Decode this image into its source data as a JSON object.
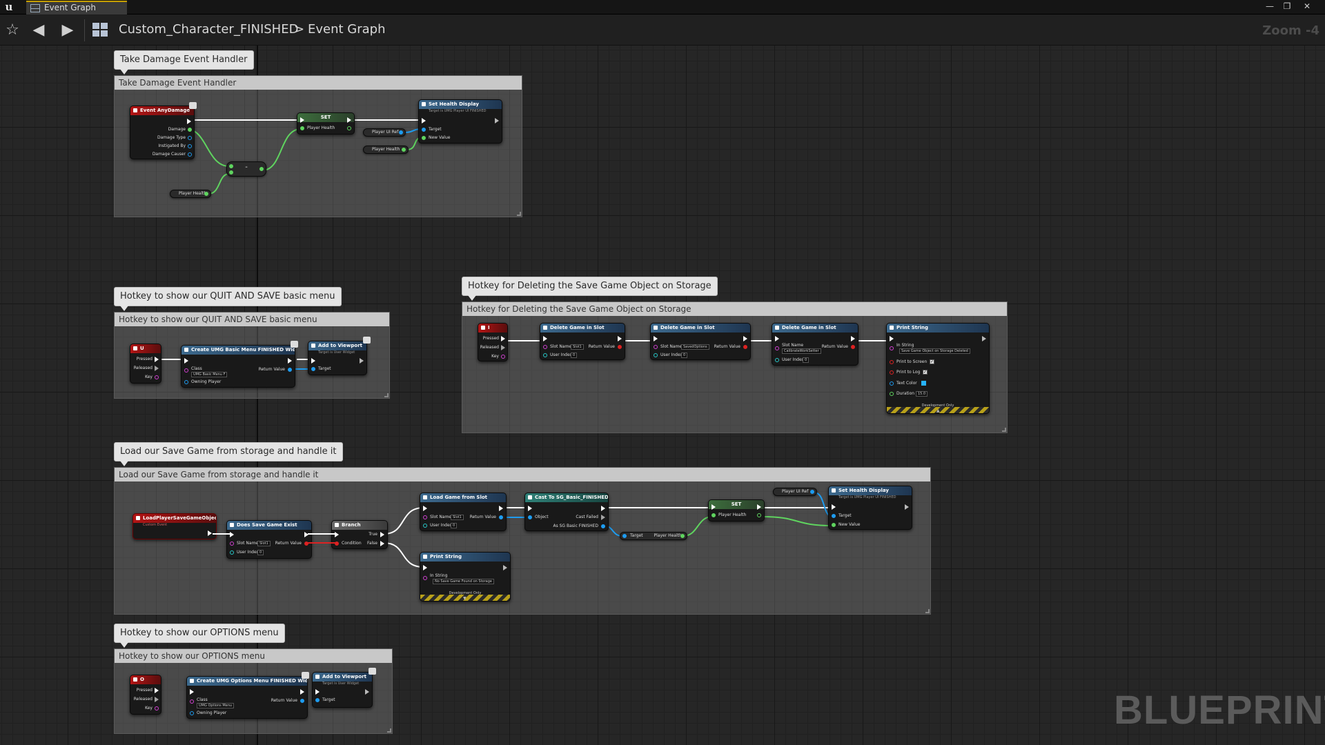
{
  "window": {
    "tab_title": "Event Graph",
    "minimize": "—",
    "restore": "❐",
    "close": "✕"
  },
  "toolbar": {
    "favorite": "☆",
    "back": "◀",
    "forward": "▶",
    "blueprint_name": "Custom_Character_FINISHED",
    "separator": ">",
    "graph_name": "Event Graph",
    "zoom": "Zoom -4"
  },
  "watermark": "BLUEPRINT",
  "colors": {
    "exec": "#ffffff",
    "float_pin": "#5fd45f",
    "object_pin": "#1e9cf0",
    "bool_pin": "#d22222",
    "event_header": "#b31515",
    "function_header": "#3d6a8e"
  },
  "comments": [
    {
      "bubble": "Take Damage Event Handler",
      "title": "Take Damage Event Handler"
    },
    {
      "bubble": "Hotkey to show our QUIT AND SAVE basic menu",
      "title": "Hotkey to show our QUIT AND SAVE basic menu"
    },
    {
      "bubble": "Hotkey for Deleting the Save Game Object on Storage",
      "title": "Hotkey for Deleting the Save Game Object on Storage"
    },
    {
      "bubble": "Load our Save Game from storage and handle it",
      "title": "Load our Save Game from storage and handle it"
    },
    {
      "bubble": "Hotkey to show our OPTIONS menu",
      "title": "Hotkey to show our OPTIONS menu"
    }
  ],
  "take_damage": {
    "event": {
      "title": "Event AnyDamage",
      "pins": [
        "Damage",
        "Damage Type",
        "Instigated By",
        "Damage Causer"
      ]
    },
    "minus": "-",
    "var_get_health": "Player Health",
    "set": {
      "title": "SET",
      "pin": "Player Health"
    },
    "var_player_ui_ref": "Player UI Ref",
    "var_player_health": "Player Health",
    "set_health": {
      "title": "Set Health Display",
      "subtitle": "Target is UMG Player UI FINISHED",
      "pins": [
        "Target",
        "New Value"
      ]
    }
  },
  "quit_menu": {
    "key": {
      "title": "U",
      "pins": [
        "Pressed",
        "Released",
        "Key"
      ]
    },
    "create": {
      "title": "Create UMG Basic Menu FINISHED Widget",
      "class_label": "Class",
      "class_value": "UMG Basic Menu F",
      "owning": "Owning Player",
      "return": "Return Value"
    },
    "add": {
      "title": "Add to Viewport",
      "subtitle": "Target is User Widget",
      "pin": "Target"
    }
  },
  "delete_save": {
    "key": {
      "title": "I",
      "pins": [
        "Pressed",
        "Released",
        "Key"
      ]
    },
    "delete_nodes": [
      {
        "title": "Delete Game in Slot",
        "slot_label": "Slot Name",
        "slot_value": "Slot1",
        "user_label": "User Index",
        "user_value": "0",
        "return": "Return Value"
      },
      {
        "title": "Delete Game in Slot",
        "slot_label": "Slot Name",
        "slot_value": "SavedOptions",
        "user_label": "User Index",
        "user_value": "0",
        "return": "Return Value"
      },
      {
        "title": "Delete Game in Slot",
        "slot_label": "Slot Name",
        "slot_value": "CalibrateWorkSetter",
        "user_label": "User Index",
        "user_value": "0",
        "return": "Return Value"
      }
    ],
    "print": {
      "title": "Print String",
      "in_label": "In String",
      "in_value": "Save Game Object on Storage Deleted",
      "screen": "Print to Screen",
      "log": "Print to Log",
      "color": "Text Color",
      "duration": "Duration",
      "duration_value": "15.0",
      "dev": "Development Only",
      "expand": "▲"
    }
  },
  "load_save": {
    "event": {
      "title": "LoadPlayerSaveGameObject",
      "subtitle": "Custom Event"
    },
    "exists": {
      "title": "Does Save Game Exist",
      "slot_label": "Slot Name",
      "slot_value": "Slot1",
      "user_label": "User Index",
      "user_value": "0",
      "return": "Return Value"
    },
    "branch": {
      "title": "Branch",
      "condition": "Condition",
      "true": "True",
      "false": "False"
    },
    "load": {
      "title": "Load Game from Slot",
      "slot_label": "Slot Name",
      "slot_value": "Slot1",
      "user_label": "User Index",
      "user_value": "0",
      "return": "Return Value"
    },
    "cast": {
      "title": "Cast To SG_Basic_FINISHED",
      "object": "Object",
      "failed": "Cast Failed",
      "as": "As SG Basic FINISHED"
    },
    "getter": {
      "target": "Target",
      "value": "Player Health"
    },
    "set": {
      "title": "SET",
      "pin": "Player Health"
    },
    "var_player_ui_ref": "Player UI Ref",
    "set_health": {
      "title": "Set Health Display",
      "subtitle": "Target is UMG Player UI FINISHED",
      "pins": [
        "Target",
        "New Value"
      ]
    },
    "print": {
      "title": "Print String",
      "in_label": "In String",
      "in_value": "No Save Game Found on Storage",
      "dev": "Development Only",
      "expand": "▼"
    }
  },
  "options_menu": {
    "key": {
      "title": "O",
      "pins": [
        "Pressed",
        "Released",
        "Key"
      ]
    },
    "create": {
      "title": "Create UMG Options Menu FINISHED Widget",
      "class_label": "Class",
      "class_value": "UMG Options Menu",
      "owning": "Owning Player",
      "return": "Return Value"
    },
    "add": {
      "title": "Add to Viewport",
      "subtitle": "Target is User Widget",
      "pin": "Target"
    }
  }
}
